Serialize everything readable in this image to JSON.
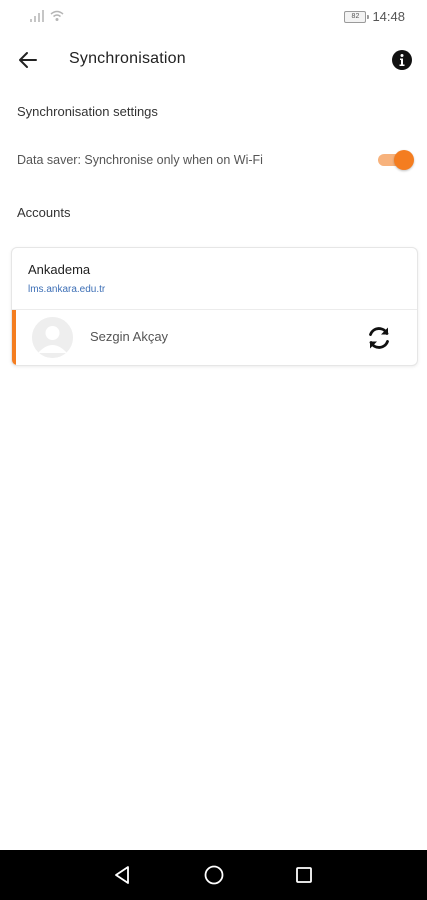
{
  "status_bar": {
    "time": "14:48",
    "battery": "82"
  },
  "app_bar": {
    "title": "Synchronisation",
    "back_icon": "arrow-left-icon",
    "info_icon": "info-icon"
  },
  "sync_settings": {
    "heading": "Synchronisation settings",
    "data_saver": {
      "label": "Data saver: Synchronise only when on Wi-Fi",
      "enabled": true
    }
  },
  "accounts": {
    "heading": "Accounts",
    "items": [
      {
        "site_name": "Ankadema",
        "site_url": "lms.ankara.edu.tr",
        "user_name": "Sezgin Akçay",
        "sync_icon": "sync-icon"
      }
    ]
  },
  "colors": {
    "accent": "#f47d20",
    "accent_light": "#f7b27c",
    "link": "#3d6fb6"
  }
}
